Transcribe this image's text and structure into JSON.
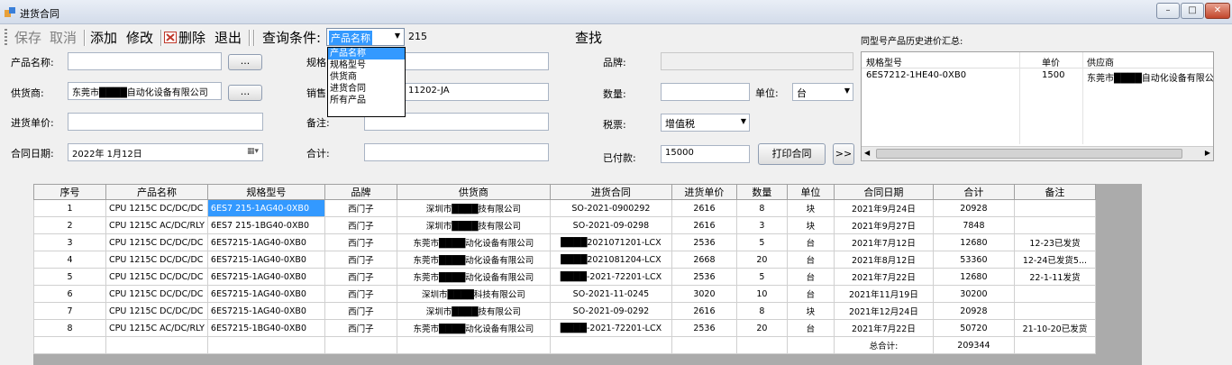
{
  "window": {
    "title": "进货合同",
    "min_label": "–",
    "max_label": "□",
    "close_label": "✕"
  },
  "toolbar": {
    "save": "保存",
    "cancel": "取消",
    "add": "添加",
    "edit": "修改",
    "delete": "删除",
    "exit": "退出",
    "query_label": "查询条件:",
    "query_selected": "产品名称",
    "query_value": "215",
    "find": "查找"
  },
  "dropdown": {
    "options": [
      "产品名称",
      "规格型号",
      "供货商",
      "进货合同",
      "所有产品"
    ]
  },
  "form": {
    "product_name_label": "产品名称:",
    "product_name_value": "",
    "browse1": "...",
    "supplier_label": "供货商:",
    "supplier_value": "东莞市████自动化设备有限公司",
    "browse2": "...",
    "unit_price_label": "进货单价:",
    "unit_price_value": "",
    "contract_date_label": "合同日期:",
    "contract_date_value": "2022年 1月12日",
    "spec_label": "规格",
    "spec_value": "",
    "sales_label": "销售",
    "sales_value": "11202-JA",
    "remark_label": "备注:",
    "remark_value": "",
    "total_label": "合计:",
    "total_value": "",
    "brand_label": "品牌:",
    "brand_value": "",
    "qty_label": "数量:",
    "qty_value": "",
    "unit_label": "单位:",
    "unit_value": "台",
    "tax_label": "税票:",
    "tax_value": "增值税",
    "paid_label": "已付款:",
    "paid_value": "15000",
    "print_button": "打印合同",
    "more_button": ">>"
  },
  "history": {
    "title": "同型号产品历史进价汇总:",
    "columns": [
      "规格型号",
      "单价",
      "供应商"
    ],
    "rows": [
      [
        "6ES7212-1HE40-0XB0",
        "1500",
        "东莞市████自动化设备有限公"
      ]
    ]
  },
  "grid": {
    "columns": [
      "序号",
      "产品名称",
      "规格型号",
      "品牌",
      "供货商",
      "进货合同",
      "进货单价",
      "数量",
      "单位",
      "合同日期",
      "合计",
      "备注"
    ],
    "rows": [
      [
        "1",
        "CPU 1215C DC/DC/DC",
        "6ES7 215-1AG40-0XB0",
        "西门子",
        "深圳市████技有限公司",
        "SO-2021-0900292",
        "2616",
        "8",
        "块",
        "2021年9月24日",
        "20928",
        ""
      ],
      [
        "2",
        "CPU 1215C AC/DC/RLY",
        "6ES7 215-1BG40-0XB0",
        "西门子",
        "深圳市████技有限公司",
        "SO-2021-09-0298",
        "2616",
        "3",
        "块",
        "2021年9月27日",
        "7848",
        ""
      ],
      [
        "3",
        "CPU 1215C DC/DC/DC",
        "6ES7215-1AG40-0XB0",
        "西门子",
        "东莞市████动化设备有限公司",
        "████2021071201-LCX",
        "2536",
        "5",
        "台",
        "2021年7月12日",
        "12680",
        "12-23已发货"
      ],
      [
        "4",
        "CPU 1215C DC/DC/DC",
        "6ES7215-1AG40-0XB0",
        "西门子",
        "东莞市████动化设备有限公司",
        "████2021081204-LCX",
        "2668",
        "20",
        "台",
        "2021年8月12日",
        "53360",
        "12-24已发货5..."
      ],
      [
        "5",
        "CPU 1215C DC/DC/DC",
        "6ES7215-1AG40-0XB0",
        "西门子",
        "东莞市████动化设备有限公司",
        "████-2021-72201-LCX",
        "2536",
        "5",
        "台",
        "2021年7月22日",
        "12680",
        "22-1-11发货"
      ],
      [
        "6",
        "CPU 1215C DC/DC/DC",
        "6ES7215-1AG40-0XB0",
        "西门子",
        "深圳市████科技有限公司",
        "SO-2021-11-0245",
        "3020",
        "10",
        "台",
        "2021年11月19日",
        "30200",
        ""
      ],
      [
        "7",
        "CPU 1215C DC/DC/DC",
        "6ES7215-1AG40-0XB0",
        "西门子",
        "深圳市████技有限公司",
        "SO-2021-09-0292",
        "2616",
        "8",
        "块",
        "2021年12月24日",
        "20928",
        ""
      ],
      [
        "8",
        "CPU 1215C AC/DC/RLY",
        "6ES7215-1BG40-0XB0",
        "西门子",
        "东莞市████动化设备有限公司",
        "████-2021-72201-LCX",
        "2536",
        "20",
        "台",
        "2021年7月22日",
        "50720",
        "21-10-20已发货"
      ]
    ],
    "footer_label": "总合计:",
    "footer_total": "209344"
  }
}
